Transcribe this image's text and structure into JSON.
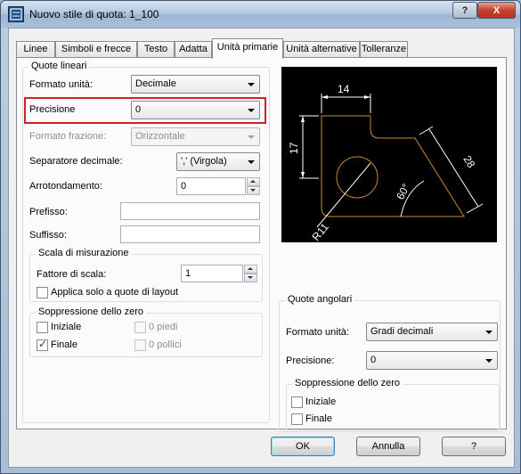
{
  "window": {
    "title": "Nuovo stile di quota: 1_100",
    "help_button": "?",
    "close_button": "X"
  },
  "tabs": [
    {
      "label": "Linee",
      "active": false
    },
    {
      "label": "Simboli e frecce",
      "active": false
    },
    {
      "label": "Testo",
      "active": false
    },
    {
      "label": "Adatta",
      "active": false
    },
    {
      "label": "Unità primarie",
      "active": true
    },
    {
      "label": "Unità alternative",
      "active": false
    },
    {
      "label": "Tolleranze",
      "active": false
    }
  ],
  "linear": {
    "title": "Quote lineari",
    "unit_format": {
      "label": "Formato unità:",
      "value": "Decimale"
    },
    "precision": {
      "label": "Precisione",
      "value": "0"
    },
    "fraction_format": {
      "label": "Formato frazione:",
      "value": "Orizzontale",
      "disabled": true
    },
    "decimal_separator": {
      "label": "Separatore decimale:",
      "value": "',' (Virgola)"
    },
    "round_off": {
      "label": "Arrotondamento:",
      "value": "0"
    },
    "prefix": {
      "label": "Prefisso:",
      "value": ""
    },
    "suffix": {
      "label": "Suffisso:",
      "value": ""
    },
    "scale": {
      "title": "Scala di misurazione",
      "factor_label": "Fattore di scala:",
      "factor_value": "1",
      "layout_only_label": "Applica solo a quote di layout",
      "layout_only_checked": false
    },
    "zero_suppression": {
      "title": "Soppressione dello zero",
      "leading": {
        "label": "Iniziale",
        "checked": false
      },
      "trailing": {
        "label": "Finale",
        "checked": true
      },
      "feet": {
        "label": "0 piedi",
        "checked": false,
        "disabled": true
      },
      "inches": {
        "label": "0 pollici",
        "checked": false,
        "disabled": true
      }
    }
  },
  "angular": {
    "title": "Quote angolari",
    "unit_format": {
      "label": "Formato unità:",
      "value": "Gradi decimali"
    },
    "precision": {
      "label": "Precisione:",
      "value": "0"
    },
    "zero_suppression": {
      "title": "Soppressione dello zero",
      "leading": {
        "label": "Iniziale",
        "checked": false
      },
      "trailing": {
        "label": "Finale",
        "checked": false
      }
    }
  },
  "preview": {
    "dim_top": "14",
    "dim_left": "17",
    "dim_slant": "28",
    "dim_angle": "60°",
    "dim_radius": "R11",
    "line_color": "#ffffff",
    "shape_color": "#c88a2e"
  },
  "buttons": {
    "ok": "OK",
    "cancel": "Annulla",
    "help": "?"
  },
  "colors": {
    "highlight_border": "#d42027",
    "titlebar": "#b3c8e0"
  }
}
